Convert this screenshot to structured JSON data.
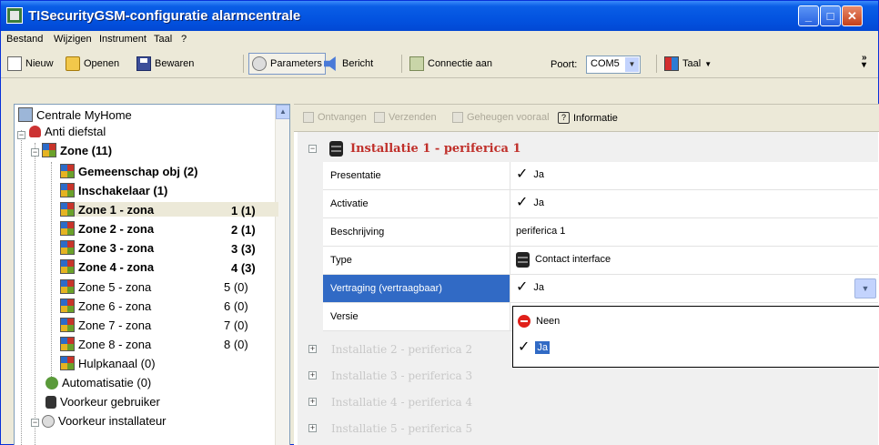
{
  "window": {
    "title": "TISecurityGSM-configuratie  alarmcentrale"
  },
  "menu": [
    "Bestand",
    "Wijzigen",
    "Instrument",
    "Taal",
    "?"
  ],
  "toolbar": {
    "new": "Nieuw",
    "open": "Openen",
    "save": "Bewaren",
    "parameters": "Parameters",
    "message": "Bericht",
    "connect": "Connectie aan",
    "port_label": "Poort:",
    "port_value": "COM5",
    "language": "Taal"
  },
  "tree": {
    "root": "Centrale MyHome",
    "anti": "Anti diefstal",
    "zone": "Zone (11)",
    "items": [
      {
        "label": "Gemeenschap obj (2)",
        "count": ""
      },
      {
        "label": "Inschakelaar (1)",
        "count": ""
      },
      {
        "label": "Zone 1 - zona",
        "count": "1 (1)"
      },
      {
        "label": "Zone 2 - zona",
        "count": "2 (1)"
      },
      {
        "label": "Zone 3 - zona",
        "count": "3 (3)"
      },
      {
        "label": "Zone 4 - zona",
        "count": "4 (3)"
      },
      {
        "label": "Zone 5 - zona",
        "count": "5 (0)"
      },
      {
        "label": "Zone 6 - zona",
        "count": "6 (0)"
      },
      {
        "label": "Zone 7 - zona",
        "count": "7 (0)"
      },
      {
        "label": "Zone 8 - zona",
        "count": "8 (0)"
      },
      {
        "label": "Hulpkanaal (0)",
        "count": ""
      }
    ],
    "automation": "Automatisatie (0)",
    "user_pref": "Voorkeur gebruiker",
    "installer_pref": "Voorkeur installateur"
  },
  "panel_toolbar": {
    "receive": "Ontvangen",
    "send": "Verzenden",
    "memory": "Geheugen vooraal",
    "info": "Informatie"
  },
  "groups": {
    "g1": "Installatie 1 - periferica 1",
    "g2": "Installatie 2 - periferica 2",
    "g3": "Installatie 3 - periferica 3",
    "g4": "Installatie 4 - periferica 4",
    "g5": "Installatie 5 - periferica 5"
  },
  "properties": {
    "presentatie": {
      "name": "Presentatie",
      "value": "Ja"
    },
    "activatie": {
      "name": "Activatie",
      "value": "Ja"
    },
    "beschrijving": {
      "name": "Beschrijving",
      "value": "periferica 1"
    },
    "type": {
      "name": "Type",
      "value": "Contact interface"
    },
    "vertraging": {
      "name": "Vertraging (vertraagbaar)",
      "value": "Ja"
    },
    "versie": {
      "name": "Versie",
      "value": ""
    }
  },
  "dropdown_options": [
    "Neen",
    "Ja"
  ]
}
